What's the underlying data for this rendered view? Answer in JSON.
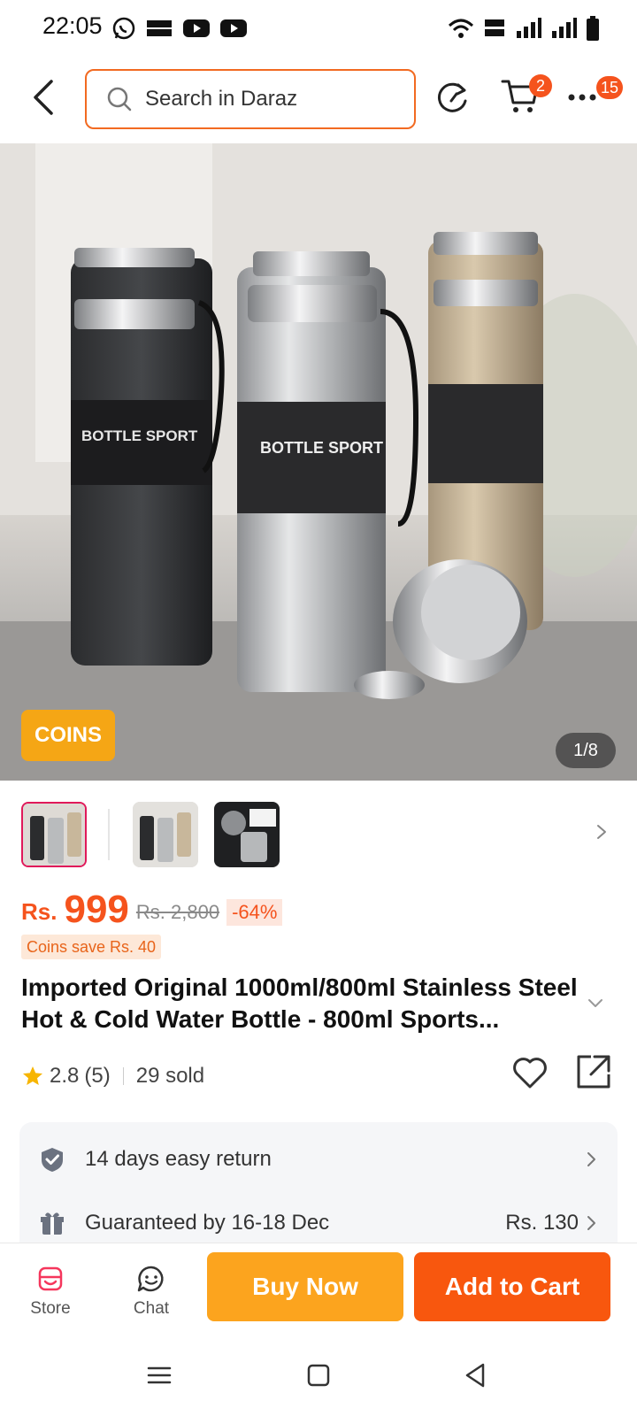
{
  "status_bar": {
    "time": "22:05"
  },
  "header": {
    "search_placeholder": "Search in Daraz",
    "cart_badge": "2",
    "more_badge": "15"
  },
  "gallery": {
    "coins_tag": "COINS",
    "pager": "1/8"
  },
  "price": {
    "currency": "Rs.",
    "current": "999",
    "original": "Rs. 2,800",
    "discount": "-64%",
    "coins_save": "Coins save Rs. 40"
  },
  "product": {
    "title": "Imported Original 1000ml/800ml Stainless Steel Hot & Cold Water Bottle - 800ml Sports...",
    "rating": "2.8",
    "reviews": "(5)",
    "sold": "29 sold"
  },
  "services": [
    {
      "label": "14 days easy return",
      "value": ""
    },
    {
      "label": "Guaranteed by 16-18 Dec",
      "value": "Rs. 130"
    }
  ],
  "action_bar": {
    "store_label": "Store",
    "chat_label": "Chat",
    "buy_now_label": "Buy Now",
    "add_to_cart_label": "Add to Cart"
  },
  "colors": {
    "brand_orange": "#f5531d",
    "buy_now": "#fca41e",
    "add_to_cart": "#f8570e",
    "coins_tag": "#f5a615"
  },
  "icons": [
    "whatsapp-icon",
    "temu-icon",
    "youtube-icon",
    "wifi-icon",
    "signal-icon",
    "battery-icon",
    "back-arrow-icon",
    "search-icon",
    "history-icon",
    "cart-icon",
    "more-icon",
    "chevron-right-icon",
    "chevron-down-icon",
    "star-icon",
    "heart-icon",
    "share-icon",
    "shield-check-icon",
    "gift-icon",
    "store-icon",
    "chat-icon",
    "menu-icon",
    "home-square-icon",
    "back-triangle-icon"
  ]
}
